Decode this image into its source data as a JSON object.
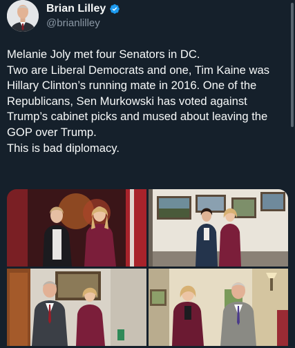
{
  "tweet": {
    "author": {
      "display_name": "Brian Lilley",
      "handle": "@brianlilley",
      "verified": true
    },
    "text": "Melanie Joly met four Senators in DC.\nTwo are Liberal Democrats and one, Tim Kaine was Hillary Clinton’s running mate in 2016. One of the Republicans, Sen Murkowski has voted against Trump’s cabinet picks and mused about leaving the GOP over Trump.\nThis is bad diplomacy.",
    "media": [
      {
        "name": "photo-1"
      },
      {
        "name": "photo-2"
      },
      {
        "name": "photo-3"
      },
      {
        "name": "photo-4"
      }
    ]
  },
  "colors": {
    "background": "#15202b",
    "text": "#f7f9f9",
    "secondary_text": "#8b98a5",
    "verified": "#1d9bf0"
  },
  "icons": {
    "verified": "verified-badge-icon"
  }
}
